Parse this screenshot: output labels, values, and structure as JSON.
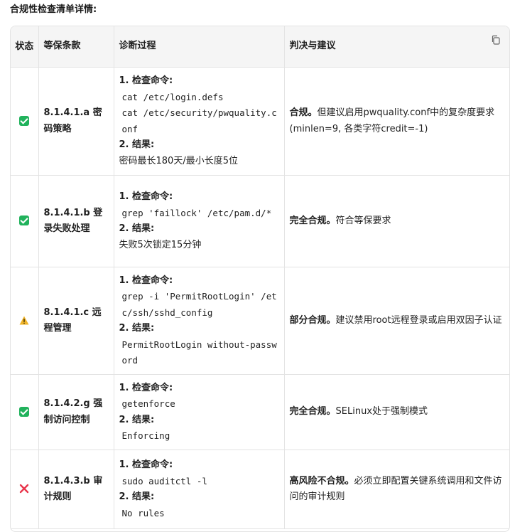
{
  "heading": "合规性检查清单详情:",
  "columns": {
    "status": "状态",
    "clause": "等保条款",
    "diagnosis": "诊断过程",
    "verdict": "判决与建议"
  },
  "labels": {
    "cmd": "1. 检查命令:",
    "result": "2. 结果:"
  },
  "icons": {
    "ok": "check-square-icon",
    "warn": "warning-icon",
    "fail": "cross-icon",
    "copy": "copy-icon",
    "ok_color": "#21b25c",
    "warn_color": "#f0b429",
    "fail_color": "#e8354b"
  },
  "rows": [
    {
      "status": "ok",
      "clause": "8.1.4.1.a 密码策略",
      "commands": [
        "cat /etc/login.defs",
        "cat /etc/security/pwquality.conf"
      ],
      "result": "密码最长180天/最小长度5位",
      "result_code": false,
      "verdict_bold": "合规。",
      "verdict_text": "但建议启用pwquality.conf中的复杂度要求(minlen=9, 各类字符credit=-1)"
    },
    {
      "status": "ok",
      "clause": "8.1.4.1.b 登录失败处理",
      "commands": [
        "grep 'faillock' /etc/pam.d/*"
      ],
      "result": "失败5次锁定15分钟",
      "result_code": false,
      "verdict_bold": "完全合规。",
      "verdict_text": "符合等保要求"
    },
    {
      "status": "warn",
      "clause": "8.1.4.1.c 远程管理",
      "commands": [
        "grep -i 'PermitRootLogin' /etc/ssh/sshd_config"
      ],
      "result": "PermitRootLogin without-password",
      "result_code": true,
      "verdict_bold": "部分合规。",
      "verdict_text": "建议禁用root远程登录或启用双因子认证"
    },
    {
      "status": "ok",
      "clause": "8.1.4.2.g 强制访问控制",
      "commands": [
        "getenforce"
      ],
      "result": "Enforcing",
      "result_code": true,
      "verdict_bold": "完全合规。",
      "verdict_text": "SELinux处于强制模式"
    },
    {
      "status": "fail",
      "clause": "8.1.4.3.b 审计规则",
      "commands": [
        "sudo auditctl -l"
      ],
      "result": "No rules",
      "result_code": true,
      "verdict_bold": "高风险不合规。",
      "verdict_text": "必须立即配置关键系统调用和文件访问的审计规则"
    }
  ]
}
